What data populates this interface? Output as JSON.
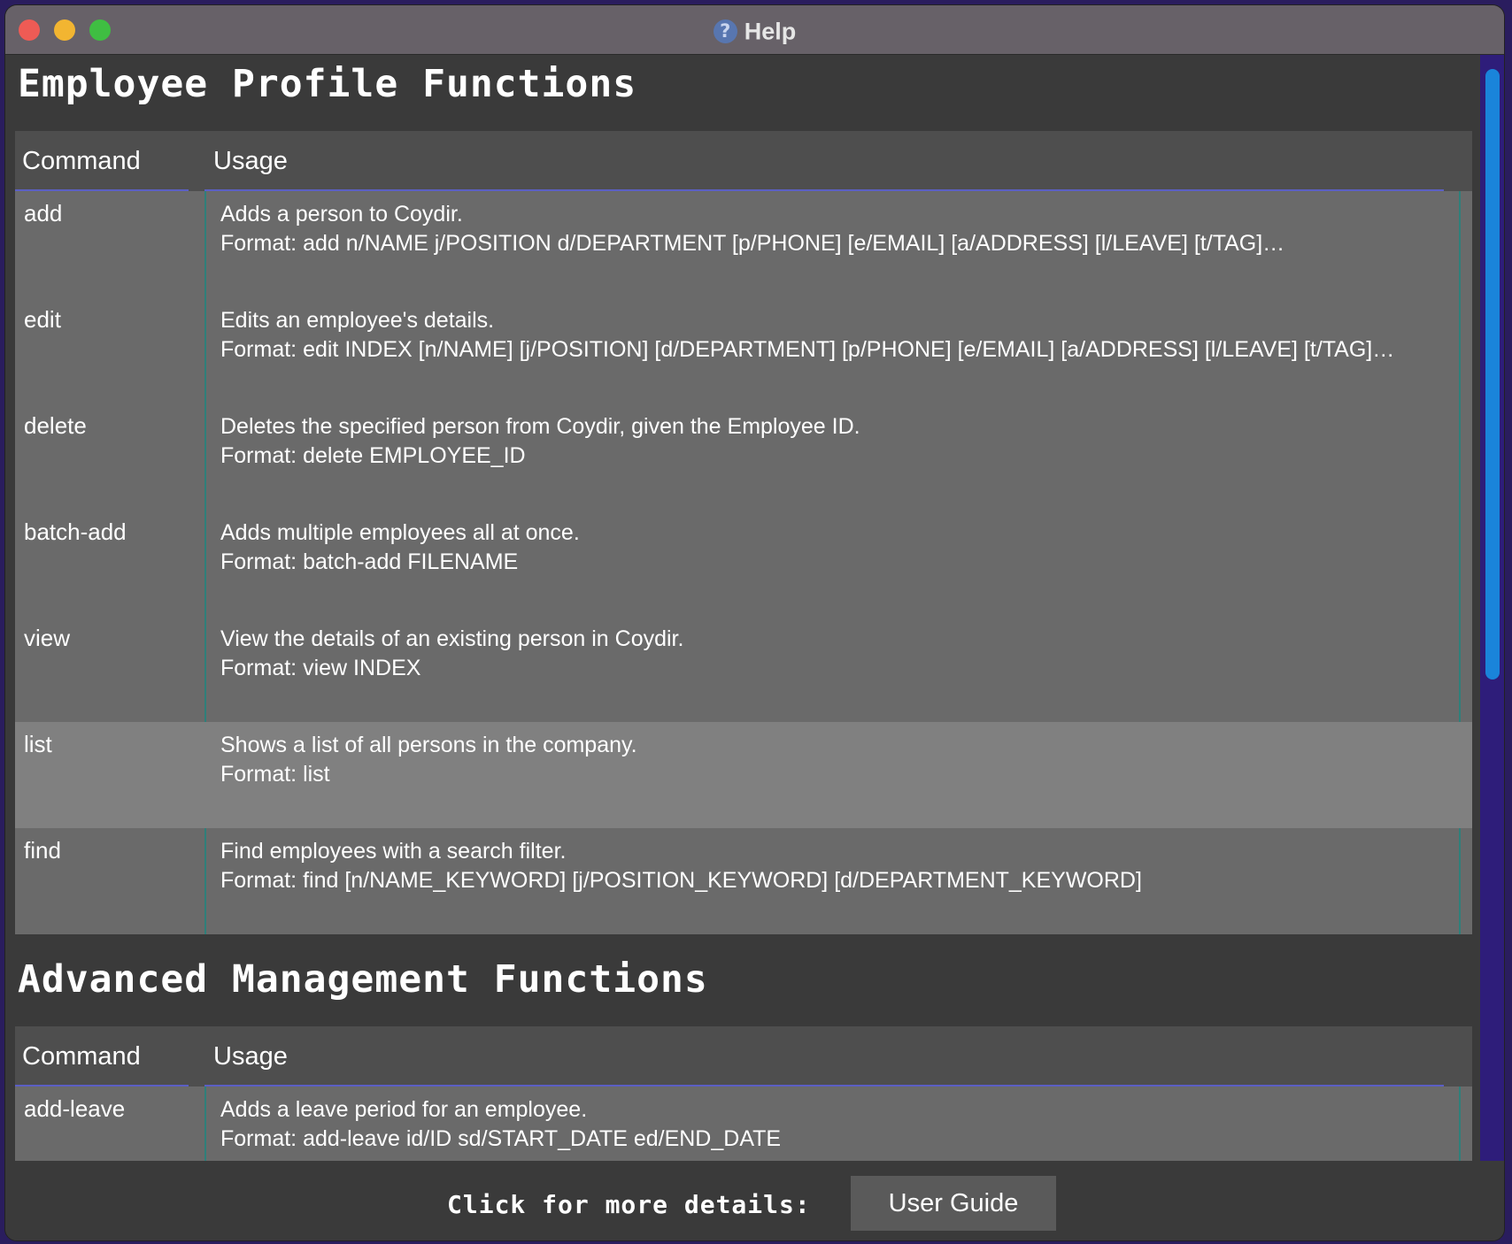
{
  "window": {
    "title": "Help",
    "title_icon": "help-icon"
  },
  "sections": [
    {
      "title": "Employee Profile Functions",
      "headers": {
        "command": "Command",
        "usage": "Usage"
      },
      "rows": [
        {
          "command": "add",
          "desc": "Adds a person to Coydir.",
          "format": "Format: add n/NAME j/POSITION d/DEPARTMENT [p/PHONE] [e/EMAIL] [a/ADDRESS] [l/LEAVE] [t/TAG]…"
        },
        {
          "command": "edit",
          "desc": "Edits an employee's details.",
          "format": "Format: edit INDEX [n/NAME] [j/POSITION] [d/DEPARTMENT] [p/PHONE] [e/EMAIL] [a/ADDRESS] [l/LEAVE] [t/TAG]…"
        },
        {
          "command": "delete",
          "desc": "Deletes the specified person from Coydir, given the Employee ID.",
          "format": "Format: delete EMPLOYEE_ID"
        },
        {
          "command": "batch-add",
          "desc": "Adds multiple employees all at once.",
          "format": "Format: batch-add FILENAME"
        },
        {
          "command": "view",
          "desc": "View the details of an existing person in Coydir.",
          "format": "Format: view INDEX"
        },
        {
          "command": "list",
          "desc": "Shows a list of all persons in the company.",
          "format": "Format: list",
          "selected": true
        },
        {
          "command": "find",
          "desc": "Find employees with a search filter.",
          "format": "Format: find [n/NAME_KEYWORD] [j/POSITION_KEYWORD] [d/DEPARTMENT_KEYWORD]"
        }
      ]
    },
    {
      "title": "Advanced Management Functions",
      "headers": {
        "command": "Command",
        "usage": "Usage"
      },
      "rows": [
        {
          "command": "add-leave",
          "desc": "Adds a leave period for an employee.",
          "format": "Format: add-leave id/ID sd/START_DATE ed/END_DATE"
        }
      ]
    }
  ],
  "footer": {
    "label": "Click for more details:",
    "button": "User Guide"
  },
  "colors": {
    "scroll_thumb": "#1a84da",
    "header_underline": "#5b5fc4",
    "column_divider": "#2f7f7a"
  }
}
